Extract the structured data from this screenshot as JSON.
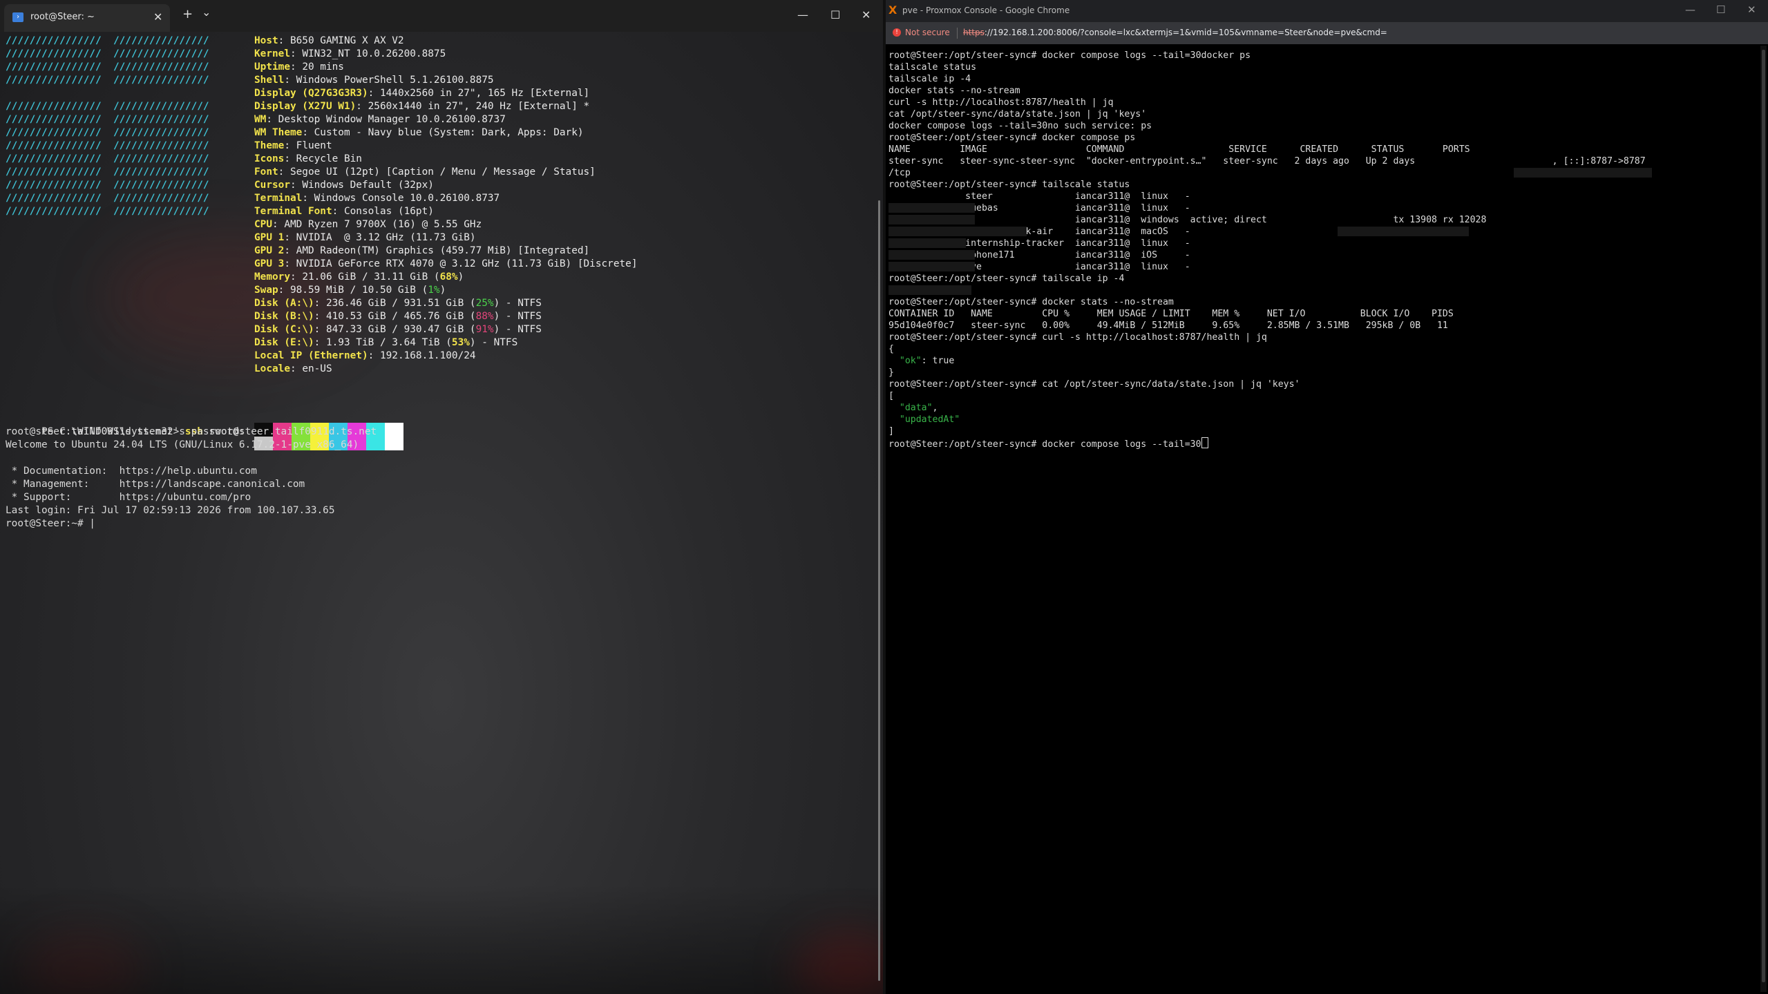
{
  "terminal": {
    "tab_title": "root@Steer: ~",
    "tab_icon": "powershell-icon",
    "new_tab": "+",
    "dropdown": "⌄",
    "close": "✕",
    "window_min": "—",
    "window_max": "☐",
    "window_close": "✕",
    "logo_row": "////////////////  ////////////////",
    "neofetch": [
      {
        "key": "Host",
        "val": "B650 GAMING X AX V2"
      },
      {
        "key": "Kernel",
        "val": "WIN32_NT 10.0.26200.8875"
      },
      {
        "key": "Uptime",
        "val": "20 mins"
      },
      {
        "key": "Shell",
        "val": "Windows PowerShell 5.1.26100.8875"
      },
      {
        "key": "Display (Q27G3G3R3)",
        "val": "1440x2560 in 27\", 165 Hz [External]"
      },
      {
        "key": "Display (X27U W1)",
        "val": "2560x1440 in 27\", 240 Hz [External] *"
      },
      {
        "key": "WM",
        "val": "Desktop Window Manager 10.0.26100.8737"
      },
      {
        "key": "WM Theme",
        "val": "Custom - Navy blue (System: Dark, Apps: Dark)"
      },
      {
        "key": "Theme",
        "val": "Fluent"
      },
      {
        "key": "Icons",
        "val": "Recycle Bin"
      },
      {
        "key": "Font",
        "val": "Segoe UI (12pt) [Caption / Menu / Message / Status]"
      },
      {
        "key": "Cursor",
        "val": "Windows Default (32px)"
      },
      {
        "key": "Terminal",
        "val": "Windows Console 10.0.26100.8737"
      },
      {
        "key": "Terminal Font",
        "val": "Consolas (16pt)"
      },
      {
        "key": "CPU",
        "val": "AMD Ryzen 7 9700X (16) @ 5.55 GHz"
      },
      {
        "key": "GPU 1",
        "val": "NVIDIA  @ 3.12 GHz (11.73 GiB)"
      },
      {
        "key": "GPU 2",
        "val": "AMD Radeon(TM) Graphics (459.77 MiB) [Integrated]"
      },
      {
        "key": "GPU 3",
        "val": "NVIDIA GeForce RTX 4070 @ 3.12 GHz (11.73 GiB) [Discrete]"
      }
    ],
    "memory": {
      "key": "Memory",
      "pre": "21.06 GiB / 31.11 GiB (",
      "pct": "68%",
      "post": ")"
    },
    "swap": {
      "key": "Swap",
      "pre": "98.59 MiB / 10.50 GiB (",
      "pct": "1%",
      "post": ")"
    },
    "disks": [
      {
        "key": "Disk (A:\\)",
        "pre": "236.46 GiB / 931.51 GiB (",
        "pct": "25%",
        "post": ") - NTFS",
        "color": "green"
      },
      {
        "key": "Disk (B:\\)",
        "pre": "410.53 GiB / 465.76 GiB (",
        "pct": "88%",
        "post": ") - NTFS",
        "color": "magenta"
      },
      {
        "key": "Disk (C:\\)",
        "pre": "847.33 GiB / 930.47 GiB (",
        "pct": "91%",
        "post": ") - NTFS",
        "color": "magenta"
      },
      {
        "key": "Disk (E:\\)",
        "pre": "1.93 TiB / 3.64 TiB (",
        "pct": "53%",
        "post": ") - NTFS",
        "color": "yellow"
      }
    ],
    "local_ip": {
      "key": "Local IP (Ethernet)",
      "val": "192.168.1.100/24"
    },
    "locale": {
      "key": "Locale",
      "val": "en-US"
    },
    "palette": [
      "#0c0c0c",
      "#e5398a",
      "#84e13a",
      "#f5f13a",
      "#39c6e5",
      "#e53ad8",
      "#3ae5e5",
      "#ffffff"
    ],
    "palette_bottom": [
      "#c8c8c8",
      "#e5398a",
      "#84e13a",
      "#f5f13a",
      "#39c6e5",
      "#e53ad8",
      "#3ae5e5",
      "#ffffff"
    ],
    "ps_prompt": "PS C:\\WINDOWS\\system32> ",
    "ssh_cmd": "ssh",
    "ssh_arg": " root@steer.tailf0911d.ts.net",
    "session": [
      "root@steer.tailf0911d.ts.net's password:",
      "Welcome to Ubuntu 24.04 LTS (GNU/Linux 6.17.2-1-pve x86_64)",
      "",
      " * Documentation:  https://help.ubuntu.com",
      " * Management:     https://landscape.canonical.com",
      " * Support:        https://ubuntu.com/pro",
      "Last login: Fri Jul 17 02:59:13 2026 from 100.107.33.65",
      "root@Steer:~# |"
    ]
  },
  "browser": {
    "title": "pve - Proxmox Console - Google Chrome",
    "logo": "X",
    "warning": "Not secure",
    "url_scheme": "https",
    "url_rest": "://192.168.1.200:8006/?console=lxc&xtermjs=1&vmid=105&vmname=Steer&node=pve&cmd=",
    "btn_min": "—",
    "btn_max": "☐",
    "btn_close": "✕",
    "console": [
      "root@Steer:/opt/steer-sync# docker compose logs --tail=30docker ps",
      "tailscale status",
      "tailscale ip -4",
      "docker stats --no-stream",
      "curl -s http://localhost:8787/health | jq",
      "cat /opt/steer-sync/data/state.json | jq 'keys'",
      "docker compose logs --tail=30no such service: ps",
      "root@Steer:/opt/steer-sync# docker compose ps",
      "NAME         IMAGE                  COMMAND                   SERVICE      CREATED      STATUS       PORTS",
      "steer-sync   steer-sync-steer-sync  \"docker-entrypoint.s…\"   steer-sync   2 days ago   Up 2 days                         , [::]:8787->8787",
      "/tcp",
      "root@Steer:/opt/steer-sync# tailscale status",
      "              steer               iancar311@  linux   -",
      "              cuebas              iancar311@  linux   -",
      "                                  iancar311@  windows  active; direct                       tx 13908 rx 12028",
      "              ians-macbook-air    iancar311@  macOS   -",
      "              internship-tracker  iancar311@  linux   -",
      "              iphone171           iancar311@  iOS     -",
      "              pve                 iancar311@  linux   -",
      "root@Steer:/opt/steer-sync# tailscale ip -4",
      "",
      "root@Steer:/opt/steer-sync# docker stats --no-stream",
      "CONTAINER ID   NAME         CPU %     MEM USAGE / LIMIT    MEM %     NET I/O          BLOCK I/O    PIDS",
      "95d104e0f0c7   steer-sync   0.00%     49.4MiB / 512MiB     9.65%     2.85MB / 3.51MB   295kB / 0B   11",
      "root@Steer:/opt/steer-sync# curl -s http://localhost:8787/health | jq",
      "{",
      "  \"ok\": true",
      "}",
      "root@Steer:/opt/steer-sync# cat /opt/steer-sync/data/state.json | jq 'keys'",
      "[",
      "  \"data\",",
      "  \"updatedAt\"",
      "]",
      "root@Steer:/opt/steer-sync# docker compose logs --tail=30"
    ]
  }
}
